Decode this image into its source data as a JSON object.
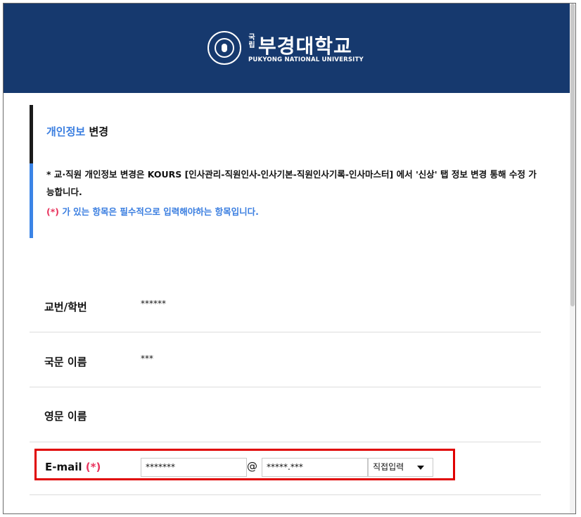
{
  "header": {
    "brand_small": "국립",
    "brand_name": "부경대학교",
    "brand_sub": "PUKYONG NATIONAL UNIVERSITY"
  },
  "section": {
    "title_highlight": "개인정보",
    "title_rest": "변경",
    "notice": "* 교·직원 개인정보 변경은 KOURS [인사관리-직원인사-인사기본-직원인사기록-인사마스터] 에서 '신상' 탭 정보 변경 통해 수정 가능합니다.",
    "required_mark": "(*)",
    "required_note": "가 있는 항목은 필수적으로 입력해야하는 항목입니다."
  },
  "form": {
    "id_label": "교번/학번",
    "id_value": "******",
    "korean_name_label": "국문 이름",
    "korean_name_value": "***",
    "english_name_label": "영문 이름",
    "email_label": "E-mail",
    "email_required_mark": "(*)",
    "email_local": "*******",
    "email_at": "@",
    "email_domain": "*****.***",
    "email_domain_select": "직접입력"
  }
}
